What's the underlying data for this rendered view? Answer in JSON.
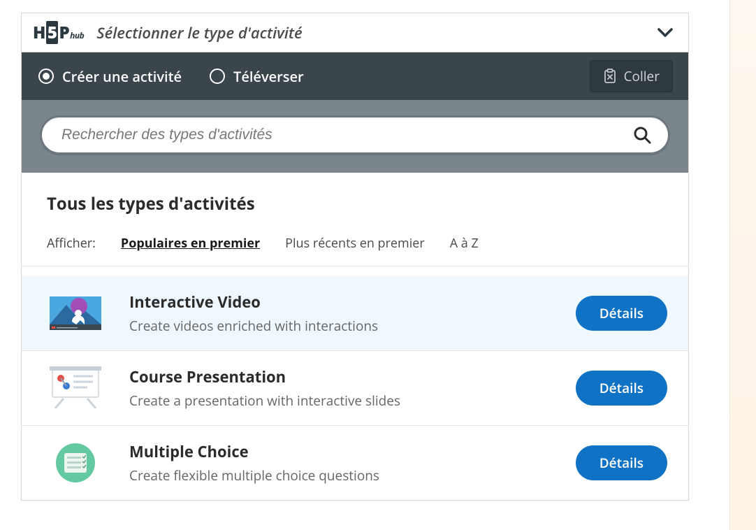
{
  "header": {
    "logo_h": "H",
    "logo_5": "5",
    "logo_p": "P",
    "logo_hub": "hub",
    "title": "Sélectionner le type d'activité"
  },
  "toolbar": {
    "create_label": "Créer une activité",
    "upload_label": "Téléverser",
    "paste_label": "Coller"
  },
  "search": {
    "placeholder": "Rechercher des types d'activités"
  },
  "list_head": {
    "title": "Tous les types d'activités",
    "show_label": "Afficher:",
    "sort_popular": "Populaires en premier",
    "sort_recent": "Plus récents en premier",
    "sort_az": "A à Z"
  },
  "details_label": "Détails",
  "items": [
    {
      "title": "Interactive Video",
      "desc": "Create videos enriched with interactions"
    },
    {
      "title": "Course Presentation",
      "desc": "Create a presentation with interactive slides"
    },
    {
      "title": "Multiple Choice",
      "desc": "Create flexible multiple choice questions"
    }
  ]
}
